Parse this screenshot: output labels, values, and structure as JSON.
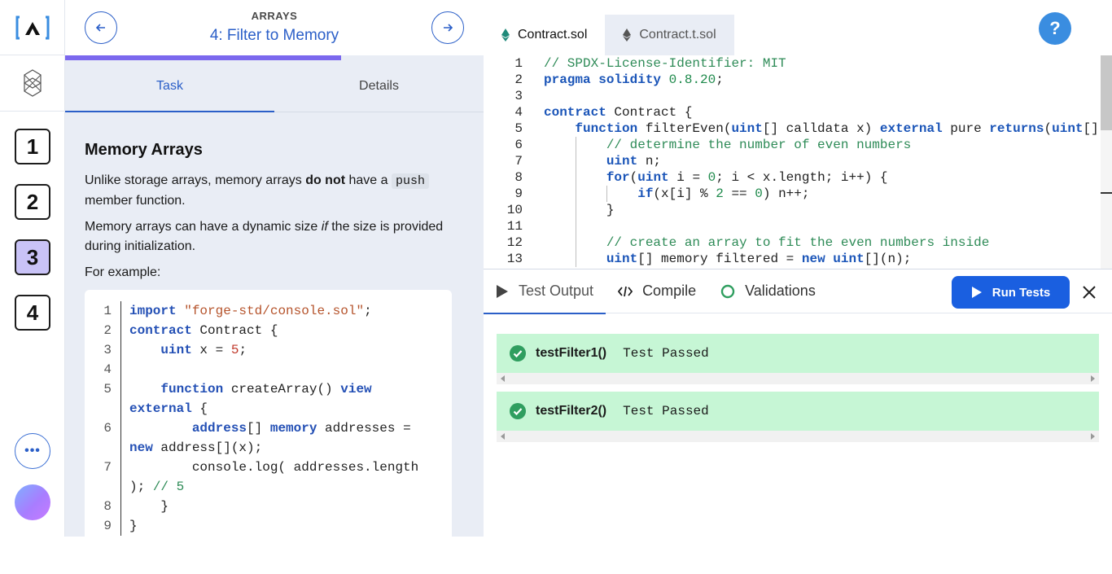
{
  "rail": {
    "stages": [
      "1",
      "2",
      "3",
      "4"
    ],
    "active_stage": "3",
    "more_label": "•••"
  },
  "lesson": {
    "category": "ARRAYS",
    "title": "4: Filter to Memory",
    "progress": 0.66,
    "tabs": [
      {
        "label": "Task",
        "active": true
      },
      {
        "label": "Details",
        "active": false
      }
    ],
    "heading": "Memory Arrays",
    "p1_before": "Unlike storage arrays, memory arrays ",
    "p1_bold": "do not",
    "p1_mid": " have a ",
    "p1_code": "push",
    "p1_after": " member function.",
    "p2_before": "Memory arrays can have a dynamic size ",
    "p2_italic": "if",
    "p2_after": " the size is provided during initialization.",
    "p3": "For example:",
    "example_code": [
      {
        "n": "1",
        "segs": [
          [
            "kw",
            "import"
          ],
          [
            "t",
            " "
          ],
          [
            "str",
            "\"forge-std/console.sol\""
          ],
          [
            "t",
            ";"
          ]
        ]
      },
      {
        "n": "2",
        "segs": [
          [
            "kw",
            "contract"
          ],
          [
            "t",
            " Contract {"
          ]
        ]
      },
      {
        "n": "3",
        "segs": [
          [
            "t",
            "    "
          ],
          [
            "kw",
            "uint"
          ],
          [
            "t",
            " x = "
          ],
          [
            "num",
            "5"
          ],
          [
            "t",
            ";"
          ]
        ]
      },
      {
        "n": "4",
        "segs": [
          [
            "t",
            " "
          ]
        ]
      },
      {
        "n": "5",
        "segs": [
          [
            "t",
            "    "
          ],
          [
            "kw",
            "function"
          ],
          [
            "t",
            " createArray() "
          ],
          [
            "kw",
            "view"
          ],
          [
            "t",
            " "
          ],
          [
            "kw",
            "external"
          ],
          [
            "t",
            " {"
          ]
        ]
      },
      {
        "n": "6",
        "segs": [
          [
            "t",
            "        "
          ],
          [
            "kw",
            "address"
          ],
          [
            "t",
            "[] "
          ],
          [
            "kw",
            "memory"
          ],
          [
            "t",
            " addresses = "
          ],
          [
            "kw",
            "new"
          ],
          [
            "t",
            " address[](x);"
          ]
        ]
      },
      {
        "n": "7",
        "segs": [
          [
            "t",
            "        console.log( addresses.length ); "
          ],
          [
            "com",
            "// 5"
          ]
        ]
      },
      {
        "n": "8",
        "segs": [
          [
            "t",
            "    }"
          ]
        ]
      },
      {
        "n": "9",
        "segs": [
          [
            "t",
            "}"
          ]
        ]
      }
    ]
  },
  "editor": {
    "tabs": [
      {
        "label": "Contract.sol",
        "active": true
      },
      {
        "label": "Contract.t.sol",
        "active": false
      }
    ],
    "help_label": "?",
    "lines": [
      {
        "n": "1",
        "segs": [
          [
            "ecom",
            "// SPDX-License-Identifier: MIT"
          ]
        ]
      },
      {
        "n": "2",
        "segs": [
          [
            "ekw",
            "pragma"
          ],
          [
            "t",
            " "
          ],
          [
            "ekw",
            "solidity"
          ],
          [
            "t",
            " "
          ],
          [
            "enum",
            "0.8.20"
          ],
          [
            "t",
            ";"
          ]
        ]
      },
      {
        "n": "3",
        "segs": [
          [
            "t",
            ""
          ]
        ]
      },
      {
        "n": "4",
        "segs": [
          [
            "ekw",
            "contract"
          ],
          [
            "t",
            " Contract {"
          ]
        ]
      },
      {
        "n": "5",
        "segs": [
          [
            "t",
            "    "
          ],
          [
            "ekw",
            "function"
          ],
          [
            "t",
            " filterEven("
          ],
          [
            "ety",
            "uint"
          ],
          [
            "t",
            "[] calldata x) "
          ],
          [
            "ekw",
            "external"
          ],
          [
            "t",
            " pure "
          ],
          [
            "ekw",
            "returns"
          ],
          [
            "t",
            "("
          ],
          [
            "ety",
            "uint"
          ],
          [
            "t",
            "[] m"
          ]
        ]
      },
      {
        "n": "6",
        "segs": [
          [
            "t",
            "        "
          ],
          [
            "ecom",
            "// determine the number of even numbers"
          ]
        ]
      },
      {
        "n": "7",
        "segs": [
          [
            "t",
            "        "
          ],
          [
            "ety",
            "uint"
          ],
          [
            "t",
            " n;"
          ]
        ]
      },
      {
        "n": "8",
        "segs": [
          [
            "t",
            "        "
          ],
          [
            "ekw",
            "for"
          ],
          [
            "t",
            "("
          ],
          [
            "ety",
            "uint"
          ],
          [
            "t",
            " i = "
          ],
          [
            "enum",
            "0"
          ],
          [
            "t",
            "; i < x.length; i++) {"
          ]
        ]
      },
      {
        "n": "9",
        "segs": [
          [
            "t",
            "            "
          ],
          [
            "ekw",
            "if"
          ],
          [
            "t",
            "(x[i] % "
          ],
          [
            "enum",
            "2"
          ],
          [
            "t",
            " == "
          ],
          [
            "enum",
            "0"
          ],
          [
            "t",
            ") n++;"
          ]
        ]
      },
      {
        "n": "10",
        "segs": [
          [
            "t",
            "        }"
          ]
        ]
      },
      {
        "n": "11",
        "segs": [
          [
            "t",
            ""
          ]
        ]
      },
      {
        "n": "12",
        "segs": [
          [
            "t",
            "        "
          ],
          [
            "ecom",
            "// create an array to fit the even numbers inside"
          ]
        ]
      },
      {
        "n": "13",
        "segs": [
          [
            "t",
            "        "
          ],
          [
            "ety",
            "uint"
          ],
          [
            "t",
            "[] memory filtered = "
          ],
          [
            "ekw",
            "new"
          ],
          [
            "t",
            " "
          ],
          [
            "ety",
            "uint"
          ],
          [
            "t",
            "[](n);"
          ]
        ]
      }
    ]
  },
  "output": {
    "tabs": [
      {
        "label": "Test Output",
        "icon": "play-icon",
        "active": true
      },
      {
        "label": "Compile",
        "icon": "code-icon",
        "active": false
      },
      {
        "label": "Validations",
        "icon": "circle-icon",
        "active": false
      }
    ],
    "run_label": "Run Tests",
    "results": [
      {
        "name": "testFilter1()",
        "status": "Test Passed"
      },
      {
        "name": "testFilter2()",
        "status": "Test Passed"
      }
    ],
    "pass_color": "#2f9e5f"
  }
}
